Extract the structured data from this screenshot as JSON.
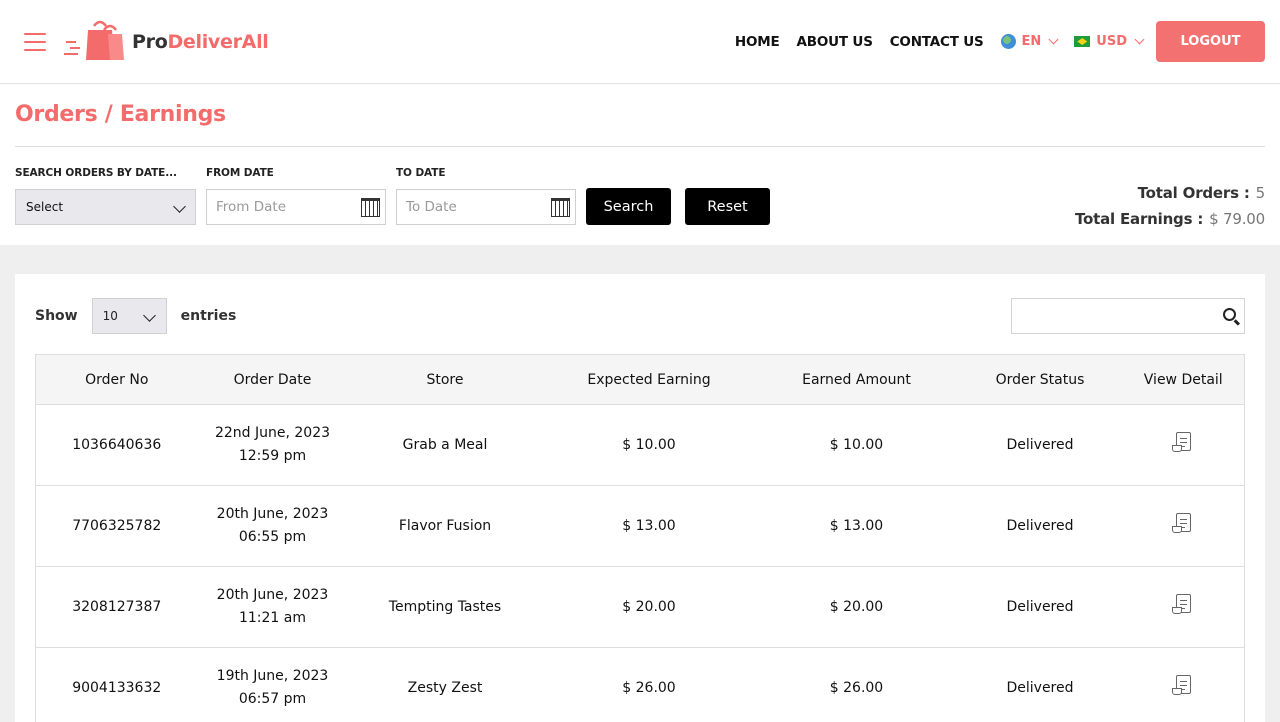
{
  "brand": {
    "pro": "Pro",
    "rest": "DeliverAll"
  },
  "nav": {
    "home": "HOME",
    "about": "ABOUT US",
    "contact": "CONTACT US",
    "language": "EN",
    "currency": "USD",
    "logout": "LOGOUT"
  },
  "page": {
    "title": "Orders / Earnings"
  },
  "filters": {
    "search_label": "SEARCH ORDERS BY DATE...",
    "search_value": "Select",
    "from_label": "FROM DATE",
    "from_placeholder": "From Date",
    "to_label": "TO DATE",
    "to_placeholder": "To Date",
    "search_button": "Search",
    "reset_button": "Reset"
  },
  "totals": {
    "orders_label": "Total Orders :",
    "orders_value": "5",
    "earnings_label": "Total Earnings :",
    "earnings_value": "$ 79.00"
  },
  "table_controls": {
    "show": "Show",
    "entries_value": "10",
    "entries": "entries"
  },
  "table": {
    "headers": [
      "Order No",
      "Order Date",
      "Store",
      "Expected Earning",
      "Earned Amount",
      "Order Status",
      "View Detail"
    ],
    "rows": [
      {
        "order_no": "1036640636",
        "date": "22nd June, 2023",
        "time": "12:59 pm",
        "store": "Grab a Meal",
        "expected": "$ 10.00",
        "earned": "$ 10.00",
        "status": "Delivered"
      },
      {
        "order_no": "7706325782",
        "date": "20th June, 2023",
        "time": "06:55 pm",
        "store": "Flavor Fusion",
        "expected": "$ 13.00",
        "earned": "$ 13.00",
        "status": "Delivered"
      },
      {
        "order_no": "3208127387",
        "date": "20th June, 2023",
        "time": "11:21 am",
        "store": "Tempting Tastes",
        "expected": "$ 20.00",
        "earned": "$ 20.00",
        "status": "Delivered"
      },
      {
        "order_no": "9004133632",
        "date": "19th June, 2023",
        "time": "06:57 pm",
        "store": "Zesty Zest",
        "expected": "$ 26.00",
        "earned": "$ 26.00",
        "status": "Delivered"
      }
    ]
  },
  "colors": {
    "accent": "#f46b6b",
    "dark_button": "#000000",
    "gray_bg": "#efefef"
  }
}
